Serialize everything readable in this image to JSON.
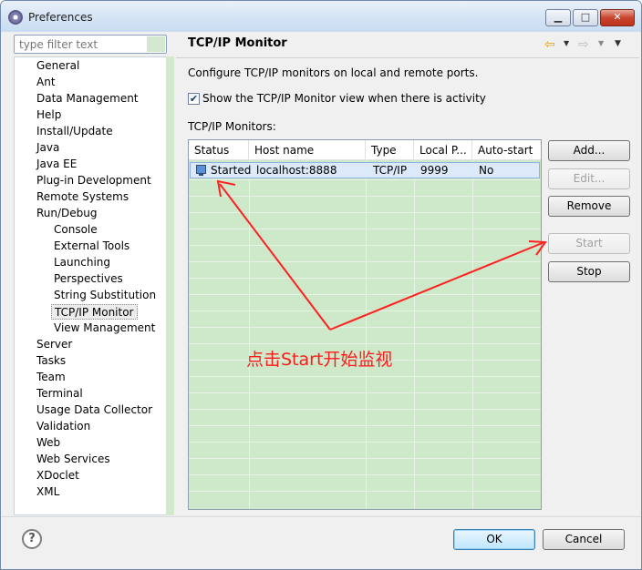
{
  "window": {
    "title": "Preferences",
    "min_glyph": "▁",
    "max_glyph": "□",
    "close_glyph": "✕"
  },
  "filter": {
    "placeholder": "type filter text"
  },
  "tree": {
    "items": [
      "General",
      "Ant",
      "Data Management",
      "Help",
      "Install/Update",
      "Java",
      "Java EE",
      "Plug-in Development",
      "Remote Systems",
      "Run/Debug",
      "Console",
      "External Tools",
      "Launching",
      "Perspectives",
      "String Substitution",
      "TCP/IP Monitor",
      "View Management",
      "Server",
      "Tasks",
      "Team",
      "Terminal",
      "Usage Data Collector",
      "Validation",
      "Web",
      "Web Services",
      "XDoclet",
      "XML"
    ],
    "selected": "TCP/IP Monitor"
  },
  "page": {
    "title": "TCP/IP Monitor",
    "description": "Configure TCP/IP monitors on local and remote ports.",
    "show_view_label": "Show the TCP/IP Monitor view when there is activity",
    "show_view_checked": true,
    "check_glyph": "✔",
    "monitors_label": "TCP/IP Monitors:"
  },
  "nav": {
    "back_glyph": "⇦",
    "fwd_glyph": "⇨",
    "menu_glyph": "▼"
  },
  "table": {
    "columns": [
      "Status",
      "Host name",
      "Type",
      "Local P...",
      "Auto-start"
    ],
    "rows": [
      {
        "status": "Started",
        "host": "localhost:8888",
        "type": "TCP/IP",
        "port": "9999",
        "autostart": "No"
      }
    ]
  },
  "buttons": {
    "add": "Add...",
    "edit": "Edit...",
    "remove": "Remove",
    "start": "Start",
    "stop": "Stop",
    "ok": "OK",
    "cancel": "Cancel",
    "help": "?"
  },
  "annotation": {
    "text": "点击Start开始监视",
    "color": "#ff1a1a"
  }
}
